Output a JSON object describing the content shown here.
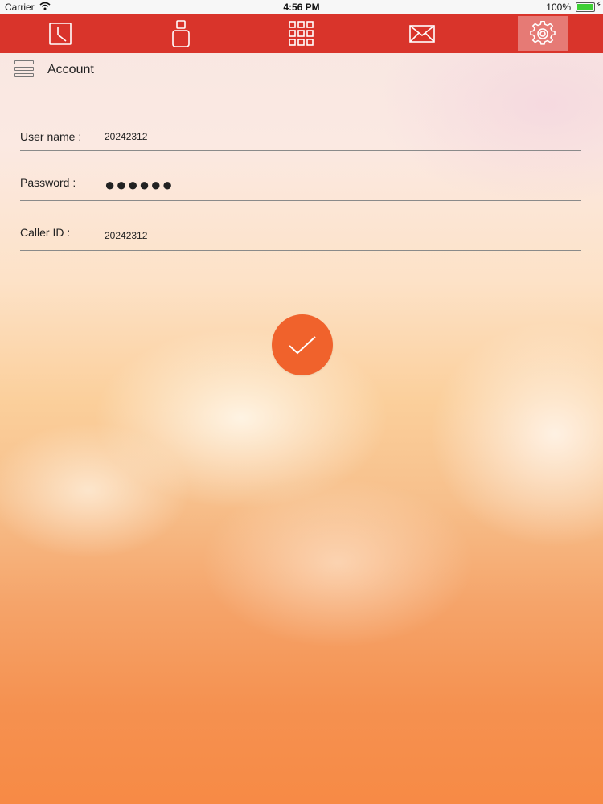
{
  "status_bar": {
    "carrier": "Carrier",
    "time": "4:56 PM",
    "battery": "100%"
  },
  "nav": {
    "tabs": [
      {
        "icon": "clock-icon",
        "active": false
      },
      {
        "icon": "contact-icon",
        "active": false
      },
      {
        "icon": "dialpad-icon",
        "active": false
      },
      {
        "icon": "mail-icon",
        "active": false
      },
      {
        "icon": "gear-icon",
        "active": true
      }
    ],
    "accent": "#d9342b"
  },
  "header": {
    "title": "Account"
  },
  "form": {
    "username_label": "User name :",
    "username_value": "20242312",
    "password_label": "Password :",
    "password_value": "●●●●●●",
    "callerid_label": "Caller ID :",
    "callerid_value": "20242312"
  },
  "submit": {
    "icon": "checkmark-icon",
    "color": "#f0622c"
  }
}
